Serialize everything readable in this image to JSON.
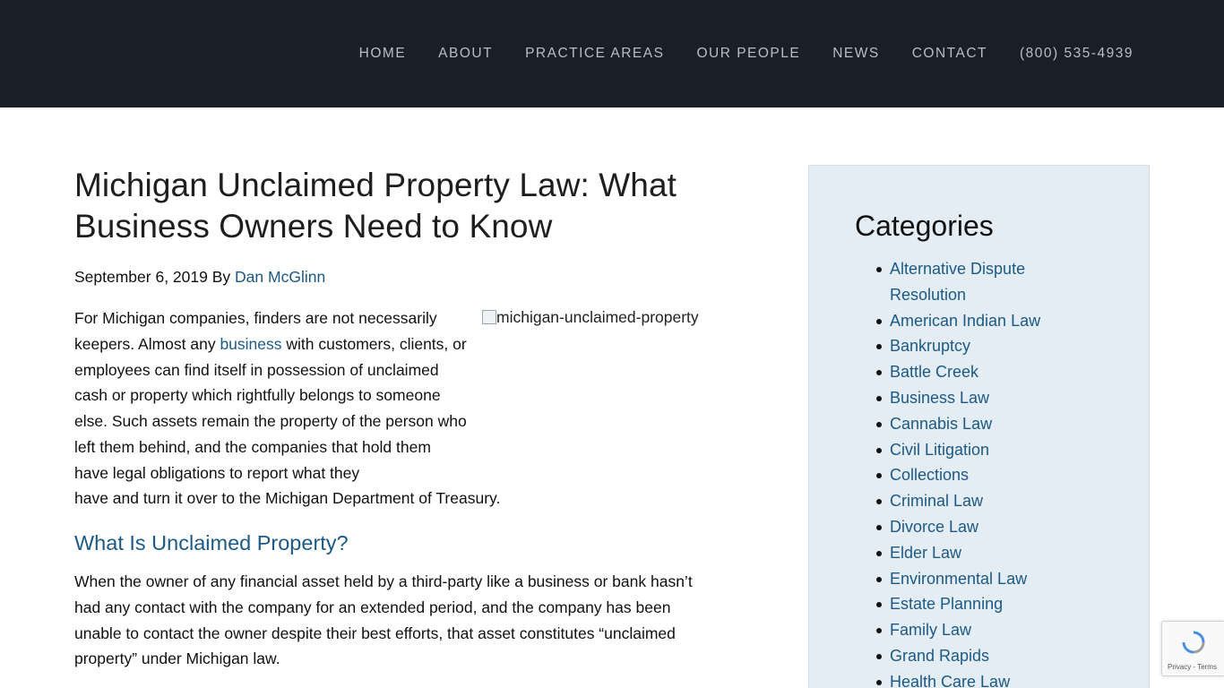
{
  "nav": {
    "items": [
      "HOME",
      "ABOUT",
      "PRACTICE AREAS",
      "OUR PEOPLE",
      "NEWS",
      "CONTACT",
      "(800) 535-4939"
    ]
  },
  "article": {
    "title": "Michigan Unclaimed Property Law: What Business Owners Need to Know",
    "date": "September 6, 2019",
    "by": "By",
    "author": "Dan McGlinn",
    "image_alt": "michigan-unclaimed-property",
    "intro_before_link": "For Michigan companies, finders are not necessarily keepers. Almost any ",
    "intro_link": "business",
    "intro_after_link": " with customers, clients, or employees can find itself in possession of unclaimed cash or property which rightfully belongs to someone else. Such assets remain the property of the person who left them behind, and the companies that hold them have legal obligations to report what they",
    "intro_last_line": "have and turn it over to the Michigan Department of Treasury.",
    "section_heading": "What Is Unclaimed Property?",
    "section_paragraph": "When the owner of any financial asset held by a third-party like a business or bank hasn’t had any contact with the company for an extended period, and the company has been unable to contact the owner despite their best efforts, that asset constitutes “unclaimed property” under Michigan law."
  },
  "sidebar": {
    "heading": "Categories",
    "categories": [
      "Alternative Dispute Resolution",
      "American Indian Law",
      "Bankruptcy",
      "Battle Creek",
      "Business Law",
      "Cannabis Law",
      "Civil Litigation",
      "Collections",
      "Criminal Law",
      "Divorce Law",
      "Elder Law",
      "Environmental Law",
      "Estate Planning",
      "Family Law",
      "Grand Rapids",
      "Health Care Law"
    ]
  },
  "recaptcha": {
    "links": "Privacy - Terms"
  },
  "colors": {
    "header_bg": "#1a1e29",
    "link": "#1c5a85",
    "sidebar_bg": "#e4ecf4"
  }
}
